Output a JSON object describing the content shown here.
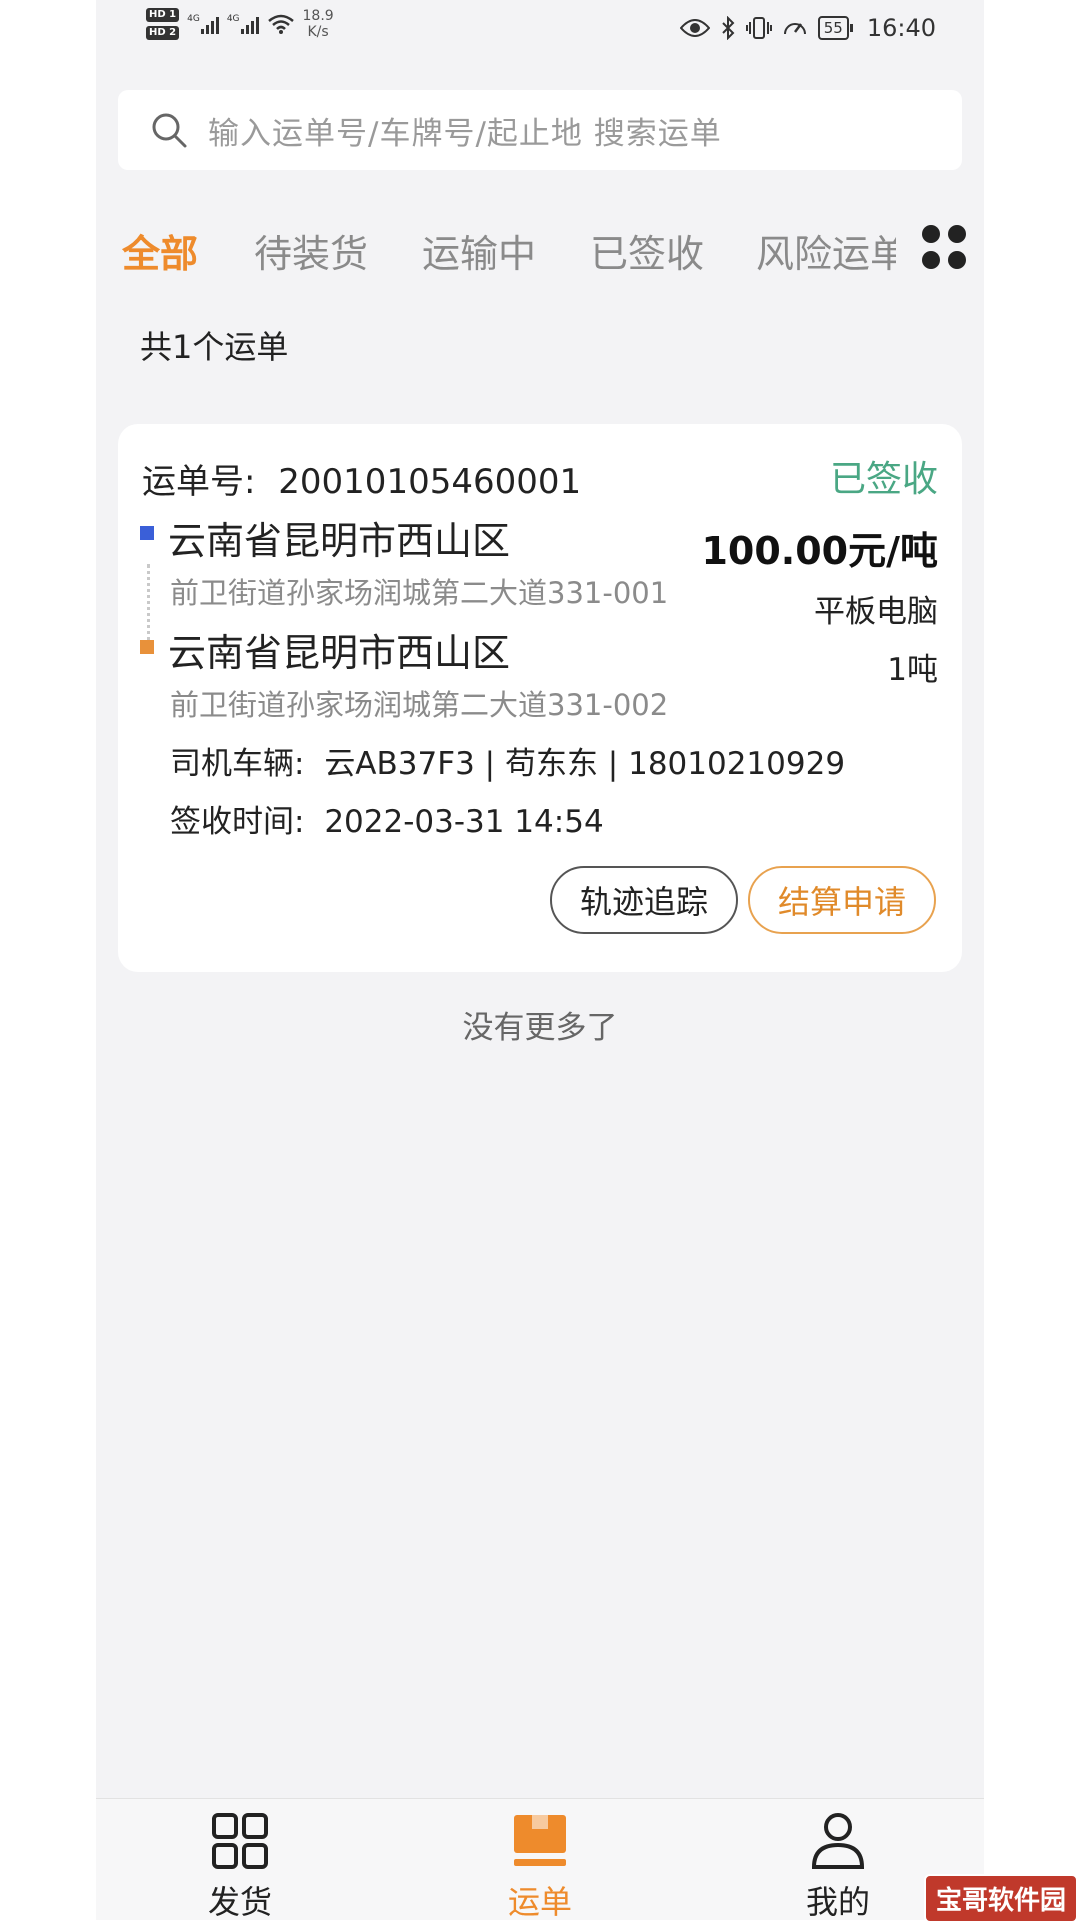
{
  "status_bar": {
    "sim1": "HD 1",
    "sim2": "HD 2",
    "network1": "4G",
    "network2": "4G",
    "speed_value": "18.9",
    "speed_unit": "K/s",
    "battery": "55",
    "time": "16:40"
  },
  "search": {
    "placeholder": "输入运单号/车牌号/起止地 搜索运单"
  },
  "tabs": [
    {
      "label": "全部",
      "active": true
    },
    {
      "label": "待装货",
      "active": false
    },
    {
      "label": "运输中",
      "active": false
    },
    {
      "label": "已签收",
      "active": false
    },
    {
      "label": "风险运单",
      "active": false
    }
  ],
  "summary": {
    "count_text": "共1个运单"
  },
  "order": {
    "number_label": "运单号:",
    "number": "20010105460001",
    "status": "已签收",
    "origin_city": "云南省昆明市西山区",
    "origin_address": "前卫街道孙家场润城第二大道331-001",
    "dest_city": "云南省昆明市西山区",
    "dest_address": "前卫街道孙家场润城第二大道331-002",
    "price": "100.00元/吨",
    "goods": "平板电脑",
    "weight": "1吨",
    "driver_label": "司机车辆:",
    "driver_info": "云AB37F3 | 苟东东 | 18010210929",
    "sign_label": "签收时间:",
    "sign_time": "2022-03-31 14:54",
    "track_button": "轨迹追踪",
    "settle_button": "结算申请"
  },
  "list_end_text": "没有更多了",
  "bottom_nav": [
    {
      "label": "发货",
      "icon": "grid-icon",
      "active": false
    },
    {
      "label": "运单",
      "icon": "box-icon",
      "active": true
    },
    {
      "label": "我的",
      "icon": "user-icon",
      "active": false
    }
  ],
  "watermark": "宝哥软件园",
  "colors": {
    "accent": "#ee8b2c",
    "status_signed": "#4aa784",
    "origin_marker": "#3a5fd8",
    "dest_marker": "#e8913a"
  }
}
